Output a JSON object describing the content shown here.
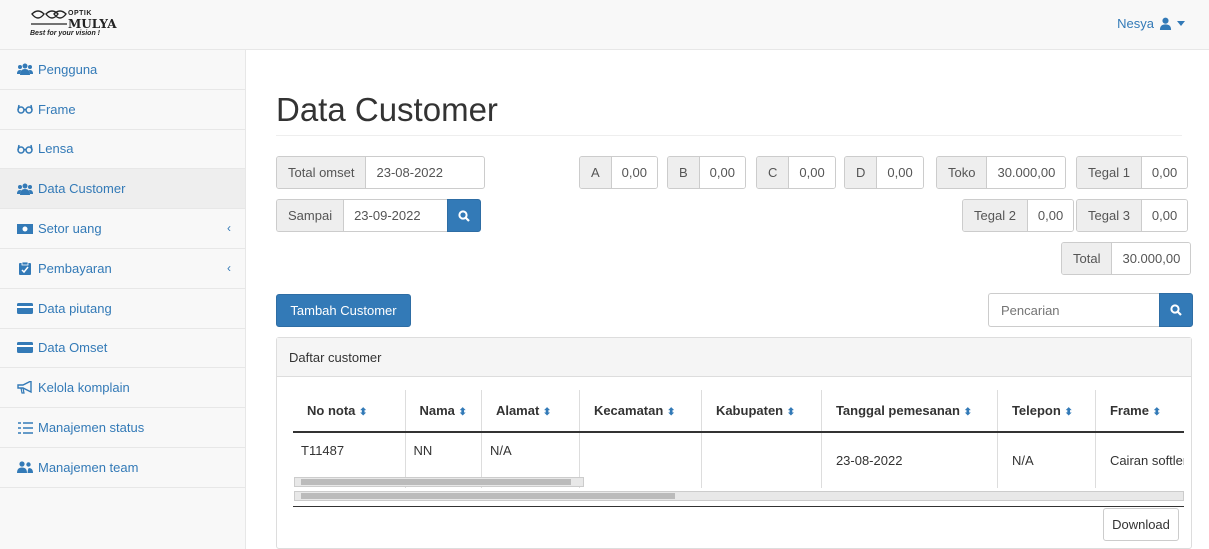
{
  "header": {
    "brand_top": "OPTIK",
    "brand_main": "MULYA",
    "brand_tagline": "Best for your vision !",
    "user_name": "Nesya"
  },
  "sidebar": {
    "items": [
      {
        "label": "Pengguna",
        "icon": "users-icon"
      },
      {
        "label": "Frame",
        "icon": "glasses-icon"
      },
      {
        "label": "Lensa",
        "icon": "glasses-icon"
      },
      {
        "label": "Data Customer",
        "icon": "users-icon",
        "active": true
      },
      {
        "label": "Setor uang",
        "icon": "money-icon",
        "has_submenu": true
      },
      {
        "label": "Pembayaran",
        "icon": "clipboard-icon",
        "has_submenu": true
      },
      {
        "label": "Data piutang",
        "icon": "credit-card-icon"
      },
      {
        "label": "Data Omset",
        "icon": "credit-card-icon"
      },
      {
        "label": "Kelola komplain",
        "icon": "bullhorn-icon"
      },
      {
        "label": "Manajemen status",
        "icon": "list-icon"
      },
      {
        "label": "Manajemen team",
        "icon": "user-friends-icon"
      }
    ]
  },
  "main": {
    "title": "Data Customer",
    "filter": {
      "total_omset_label": "Total omset",
      "from_date": "23-08-2022",
      "sampai_label": "Sampai",
      "to_date": "23-09-2022"
    },
    "summary": [
      {
        "label": "A",
        "value": "0,00"
      },
      {
        "label": "B",
        "value": "0,00"
      },
      {
        "label": "C",
        "value": "0,00"
      },
      {
        "label": "D",
        "value": "0,00"
      },
      {
        "label": "Toko",
        "value": "30.000,00"
      },
      {
        "label": "Tegal 1",
        "value": "0,00"
      },
      {
        "label": "Tegal 2",
        "value": "0,00"
      },
      {
        "label": "Tegal 3",
        "value": "0,00"
      },
      {
        "label": "Total",
        "value": "30.000,00"
      }
    ],
    "add_button": "Tambah Customer",
    "search_placeholder": "Pencarian",
    "panel_title": "Daftar customer",
    "table": {
      "columns": [
        "No nota",
        "Nama",
        "Alamat",
        "Kecamatan",
        "Kabupaten",
        "Tanggal pemesanan",
        "Telepon",
        "Frame"
      ],
      "rows": [
        [
          "T11487",
          "NN",
          "N/A",
          "",
          "",
          "23-08-2022",
          "N/A",
          "Cairan softlen"
        ]
      ]
    },
    "download_button": "Download"
  },
  "colors": {
    "primary": "#337ab7",
    "sidebar_bg": "#f8f8f8",
    "addon_bg": "#eeeeee"
  }
}
